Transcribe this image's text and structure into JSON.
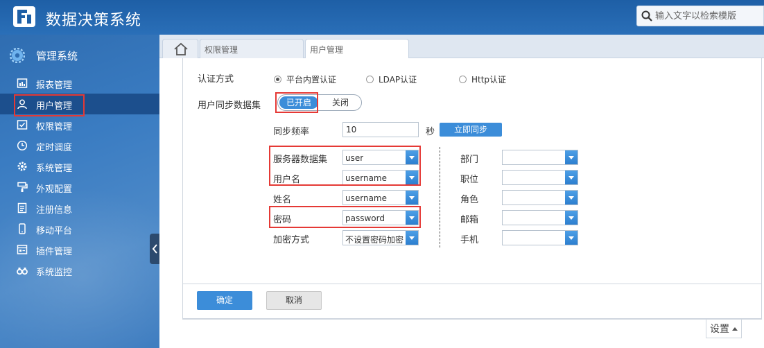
{
  "header": {
    "app_title": "数据决策系统",
    "search_placeholder": "输入文字以检索模版",
    "brand_color": "#2a6fb8"
  },
  "sidebar": {
    "title": "管理系统",
    "items": [
      {
        "label": "报表管理",
        "icon": "report-icon"
      },
      {
        "label": "用户管理",
        "icon": "user-icon",
        "active": true
      },
      {
        "label": "权限管理",
        "icon": "permission-icon"
      },
      {
        "label": "定时调度",
        "icon": "clock-icon"
      },
      {
        "label": "系统管理",
        "icon": "gear-icon"
      },
      {
        "label": "外观配置",
        "icon": "paint-roller-icon"
      },
      {
        "label": "注册信息",
        "icon": "register-icon"
      },
      {
        "label": "移动平台",
        "icon": "mobile-icon"
      },
      {
        "label": "插件管理",
        "icon": "plugin-icon"
      },
      {
        "label": "系统监控",
        "icon": "binoculars-icon"
      }
    ]
  },
  "tabs": [
    {
      "label": "权限管理"
    },
    {
      "label": "用户管理",
      "active": true
    }
  ],
  "form": {
    "auth_label": "认证方式",
    "auth_options": [
      {
        "label": "平台内置认证",
        "selected": true
      },
      {
        "label": "LDAP认证",
        "selected": false
      },
      {
        "label": "Http认证",
        "selected": false
      }
    ],
    "sync_dataset_label": "用户同步数据集",
    "toggle_on": "已开启",
    "toggle_off": "关闭",
    "sync_freq_label": "同步频率",
    "sync_freq_value": "10",
    "sync_freq_unit": "秒",
    "sync_now": "立即同步",
    "left_fields": [
      {
        "label": "服务器数据集",
        "value": "user"
      },
      {
        "label": "用户名",
        "value": "username"
      },
      {
        "label": "姓名",
        "value": "username"
      },
      {
        "label": "密码",
        "value": "password"
      },
      {
        "label": "加密方式",
        "value": "不设置密码加密"
      }
    ],
    "right_fields": [
      {
        "label": "部门",
        "value": ""
      },
      {
        "label": "职位",
        "value": ""
      },
      {
        "label": "角色",
        "value": ""
      },
      {
        "label": "邮箱",
        "value": ""
      },
      {
        "label": "手机",
        "value": ""
      }
    ]
  },
  "footer": {
    "ok": "确定",
    "cancel": "取消",
    "settings": "设置"
  },
  "highlight_color": "#e53935",
  "accent_color": "#3c8dd9"
}
